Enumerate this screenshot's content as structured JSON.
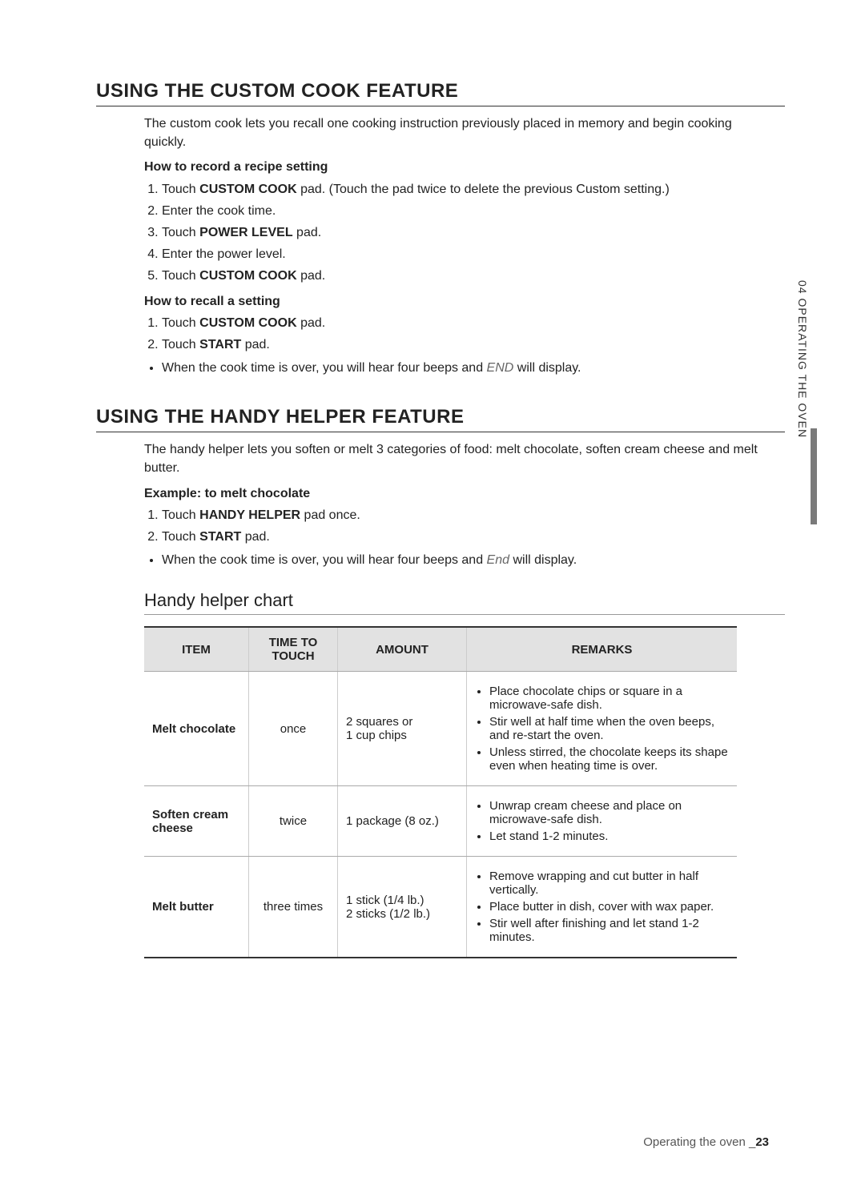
{
  "sideTab": "04  OPERATING THE OVEN",
  "section1": {
    "title": "USING THE CUSTOM COOK FEATURE",
    "intro": "The custom cook lets you recall one cooking instruction previously placed in memory and begin cooking quickly.",
    "recordHeading": "How to record a recipe setting",
    "recordSteps": {
      "s1_pre": "Touch ",
      "s1_bold": "CUSTOM COOK",
      "s1_post": " pad. (Touch the pad twice to delete the previous Custom setting.)",
      "s2": "Enter the cook time.",
      "s3_pre": "Touch ",
      "s3_bold": "POWER LEVEL",
      "s3_post": " pad.",
      "s4": "Enter the power level.",
      "s5_pre": "Touch ",
      "s5_bold": "CUSTOM COOK",
      "s5_post": " pad."
    },
    "recallHeading": "How to recall a setting",
    "recallSteps": {
      "s1_pre": "Touch ",
      "s1_bold": "CUSTOM COOK",
      "s1_post": " pad.",
      "s2_pre": "Touch ",
      "s2_bold": "START",
      "s2_post": " pad."
    },
    "recallNote_pre": "When the cook time is over, you will hear four beeps and ",
    "recallNote_italic": "END",
    "recallNote_post": " will display."
  },
  "section2": {
    "title": "USING THE HANDY HELPER FEATURE",
    "intro": "The handy helper lets you soften or melt 3 categories of food: melt chocolate, soften cream cheese and melt butter.",
    "exampleHeading": "Example: to melt chocolate",
    "exampleSteps": {
      "s1_pre": "Touch ",
      "s1_bold": "HANDY HELPER",
      "s1_post": " pad once.",
      "s2_pre": "Touch ",
      "s2_bold": "START",
      "s2_post": " pad."
    },
    "exampleNote_pre": "When the cook time is over, you will hear four beeps and ",
    "exampleNote_italic": "End",
    "exampleNote_post": " will display."
  },
  "chart": {
    "title": "Handy helper chart",
    "headers": {
      "item": "ITEM",
      "time": "TIME TO TOUCH",
      "amount": "AMOUNT",
      "remarks": "REMARKS"
    },
    "rows": [
      {
        "item": "Melt chocolate",
        "time": "once",
        "amount_l1": "2 squares or",
        "amount_l2": "1 cup chips",
        "remarks": [
          "Place chocolate chips or square in a microwave-safe dish.",
          "Stir well at half time when the oven beeps, and re-start the oven.",
          "Unless stirred, the chocolate keeps its shape even when heating time is over."
        ]
      },
      {
        "item": "Soften cream cheese",
        "time": "twice",
        "amount_l1": "1 package (8 oz.)",
        "amount_l2": "",
        "remarks": [
          "Unwrap cream cheese and place on microwave-safe dish.",
          "Let stand 1-2 minutes."
        ]
      },
      {
        "item": "Melt butter",
        "time": "three times",
        "amount_l1": "1 stick (1/4 lb.)",
        "amount_l2": "2 sticks (1/2 lb.)",
        "remarks": [
          "Remove wrapping and cut butter in half vertically.",
          "Place butter in dish, cover with wax paper.",
          "Stir well after finishing and let stand 1-2 minutes."
        ]
      }
    ]
  },
  "footer": {
    "text": "Operating the oven _",
    "page": "23"
  }
}
